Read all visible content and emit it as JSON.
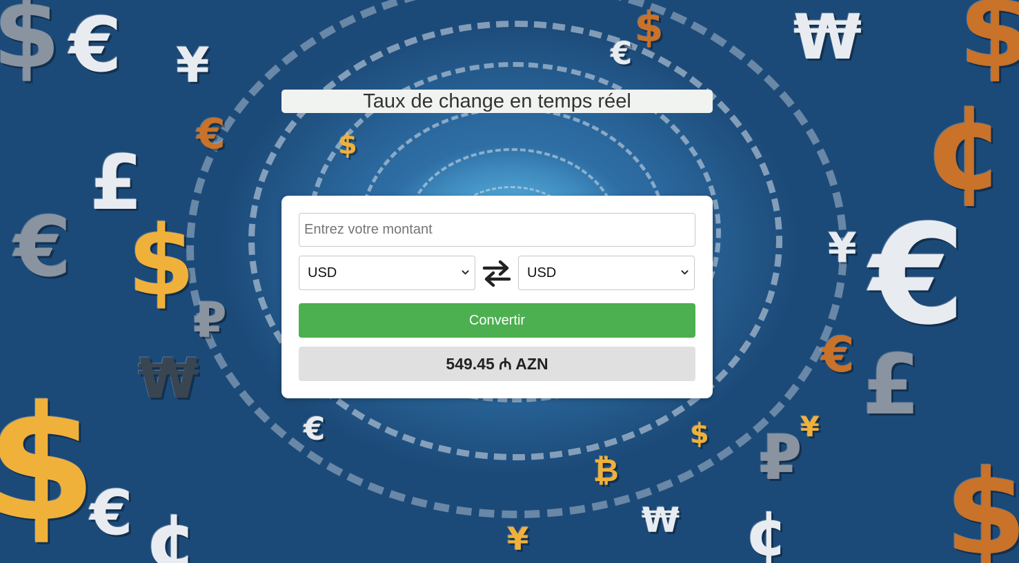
{
  "header": {
    "title": "Taux de change en temps réel"
  },
  "converter": {
    "amount_placeholder": "Entrez votre montant",
    "amount_value": "",
    "from_currency": "USD",
    "to_currency": "USD",
    "convert_label": "Convertir",
    "result_text": "549.45 ₼ AZN"
  },
  "colors": {
    "convert_button": "#4caf50",
    "result_background": "#e0e0e0",
    "card_background": "#ffffff",
    "background_blue": "#2c6aa0"
  },
  "icons": {
    "swap": "swap-arrows-icon",
    "select_chevron": "chevron-down-icon"
  }
}
